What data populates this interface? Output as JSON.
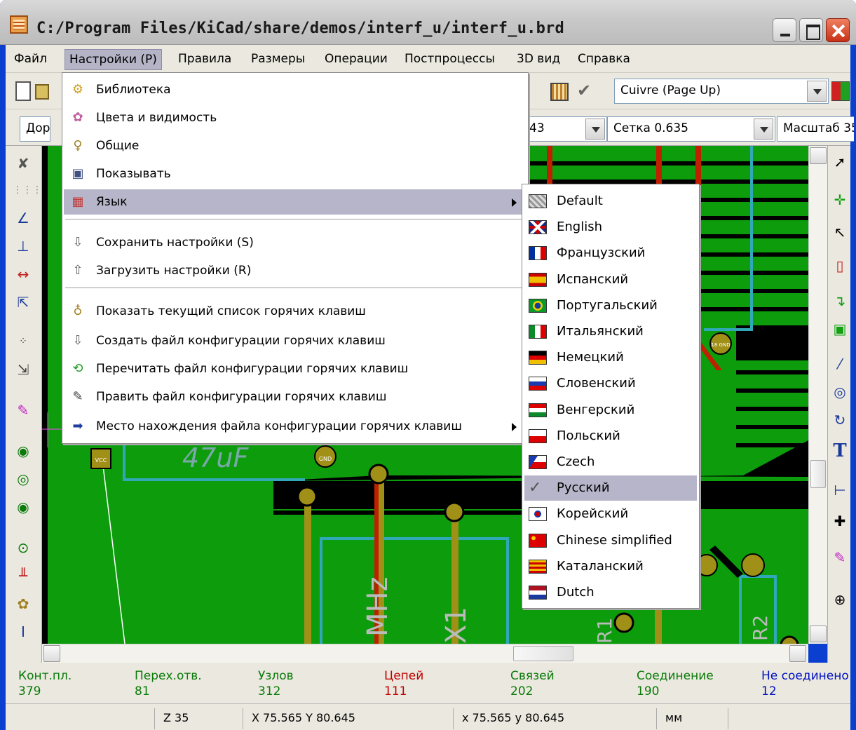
{
  "window": {
    "title": "C:/Program Files/KiCad/share/demos/interf_u/interf_u.brd"
  },
  "menubar": {
    "items": [
      "Файл",
      "Настройки (P)",
      "Правила",
      "Размеры",
      "Операции",
      "Постпроцессы",
      "3D вид",
      "Справка"
    ]
  },
  "toolbar": {
    "layer_select": "Cuivre (Page Up)",
    "track_select": "Доро",
    "via_select": "43",
    "grid_select": "Сетка 0.635",
    "zoom_select": "Масштаб 35"
  },
  "settings_menu": {
    "items": [
      {
        "label": "Библиотека",
        "icon": "library-icon"
      },
      {
        "label": "Цвета и видимость",
        "icon": "palette-icon"
      },
      {
        "label": "Общие",
        "icon": "general-icon"
      },
      {
        "label": "Показывать",
        "icon": "display-icon"
      },
      {
        "label": "Язык",
        "icon": "language-icon"
      },
      {
        "label": "Сохранить настройки (S)",
        "icon": "save-settings-icon"
      },
      {
        "label": "Загрузить настройки (R)",
        "icon": "load-settings-icon"
      },
      {
        "label": "Показать текущий список горячих клавиш",
        "icon": "hotkey-list-icon"
      },
      {
        "label": "Создать файл конфигурации горячих клавиш",
        "icon": "create-hotkey-file-icon"
      },
      {
        "label": "Перечитать файл конфигурации горячих клавиш",
        "icon": "reload-hotkey-file-icon"
      },
      {
        "label": "Править файл конфигурации горячих клавиш",
        "icon": "edit-hotkey-file-icon"
      },
      {
        "label": "Место нахождения файла конфигурации горячих клавиш",
        "icon": "arrow-right-icon"
      }
    ]
  },
  "language_menu": {
    "items": [
      {
        "label": "Default",
        "flag": "default"
      },
      {
        "label": "English",
        "flag": "uk"
      },
      {
        "label": "Французский",
        "flag": "fr"
      },
      {
        "label": "Испанский",
        "flag": "es"
      },
      {
        "label": "Португальский",
        "flag": "br"
      },
      {
        "label": "Итальянский",
        "flag": "it"
      },
      {
        "label": "Немецкий",
        "flag": "de"
      },
      {
        "label": "Словенский",
        "flag": "si"
      },
      {
        "label": "Венгерский",
        "flag": "hu"
      },
      {
        "label": "Польский",
        "flag": "pl"
      },
      {
        "label": "Czech",
        "flag": "cz"
      },
      {
        "label": "Русский",
        "flag": "check"
      },
      {
        "label": "Корейский",
        "flag": "kr"
      },
      {
        "label": "Chinese simplified",
        "flag": "cn"
      },
      {
        "label": "Каталанский",
        "flag": "ca"
      },
      {
        "label": "Dutch",
        "flag": "nl"
      }
    ],
    "selected": "Русский"
  },
  "board_labels": {
    "cap_value": "47uF",
    "crystal_freq": "MHz",
    "crystal_ref": "X1",
    "r1": "R1",
    "r2": "R2",
    "pad_vcc": "VCC",
    "pad_gnd": "GND",
    "pad_18gnd": "18 GND"
  },
  "message_panel": {
    "columns": [
      {
        "label": "Конт.пл.",
        "value": "379",
        "color": "#0a7a0a"
      },
      {
        "label": "Перех.отв.",
        "value": "81",
        "color": "#0a7a0a"
      },
      {
        "label": "Узлов",
        "value": "312",
        "color": "#0a7a0a"
      },
      {
        "label": "Цепей",
        "value": "111",
        "color": "#c00000"
      },
      {
        "label": "Связей",
        "value": "202",
        "color": "#0a7a0a"
      },
      {
        "label": "Соединение",
        "value": "190",
        "color": "#0a7a0a"
      },
      {
        "label": "Не соединено",
        "value": "12",
        "color": "#0010c0"
      }
    ]
  },
  "statusbar": {
    "zoom": "Z 35",
    "abs_coords": "X 75.565  Y 80.645",
    "rel_coords": "x 75.565  y 80.645",
    "units": "мм"
  },
  "colors": {
    "board_green": "#0c9c0c",
    "track_green": "#1aa21a",
    "track_red": "#c02000",
    "track_olive": "#a09018",
    "outline_cyan": "#30a8b8",
    "menu_highlight": "#b6b5c9"
  }
}
